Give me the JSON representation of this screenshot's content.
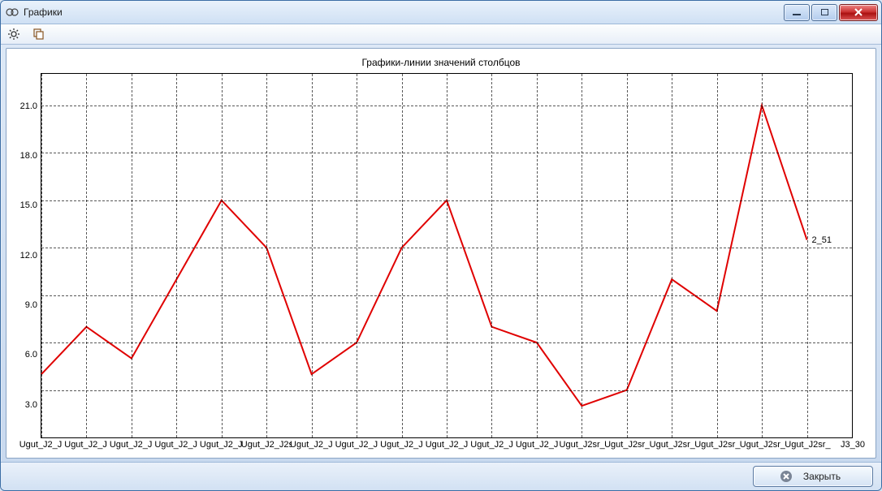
{
  "window": {
    "title": "Графики"
  },
  "footer": {
    "close_label": "Закрыть"
  },
  "chart_data": {
    "type": "line",
    "title": "Графики-линии значений столбцов",
    "xlabel": "",
    "ylabel": "",
    "ylim": [
      0,
      23
    ],
    "y_ticks": [
      3.0,
      6.0,
      9.0,
      12.0,
      15.0,
      18.0,
      21.0
    ],
    "categories": [
      "Ugut_J2_J",
      "Ugut_J2_J",
      "Ugut_J2_J",
      "Ugut_J2_J",
      "Ugut_J2_J",
      "Ugut_J2_J2s",
      "Ugut_J2_J",
      "Ugut_J2_J",
      "Ugut_J2_J",
      "Ugut_J2_J",
      "Ugut_J2_J",
      "Ugut_J2_J",
      "Ugut_J2sr_",
      "Ugut_J2sr_",
      "Ugut_J2sr_",
      "Ugut_J2sr_",
      "Ugut_J2sr_",
      "Ugut_J2sr_",
      "J3_30"
    ],
    "values": [
      4,
      7,
      5,
      10,
      15,
      12,
      4,
      6,
      12,
      15,
      7,
      6,
      2,
      3,
      10,
      8,
      21,
      12.5
    ],
    "annotations": [
      {
        "text": "2_51",
        "point_index": 17,
        "dx": 8,
        "dy": -4
      }
    ]
  }
}
